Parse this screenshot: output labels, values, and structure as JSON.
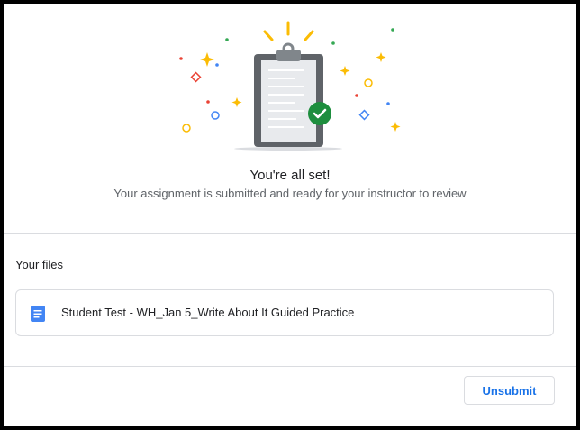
{
  "confirmation": {
    "title": "You're all set!",
    "message": "Your assignment is submitted and ready for your instructor to review",
    "illustration_icon": "clipboard-check-icon"
  },
  "files": {
    "heading": "Your files",
    "items": [
      {
        "name": "Student Test - WH_Jan 5_Write About It Guided Practice",
        "icon": "google-docs-icon"
      }
    ]
  },
  "actions": {
    "unsubmit_label": "Unsubmit"
  },
  "colors": {
    "accent_blue": "#1a73e8",
    "docs_blue": "#4285f4",
    "success_green": "#1e8e3e",
    "confetti_yellow": "#fbbc04",
    "confetti_red": "#ea4335",
    "confetti_green": "#34a853"
  }
}
